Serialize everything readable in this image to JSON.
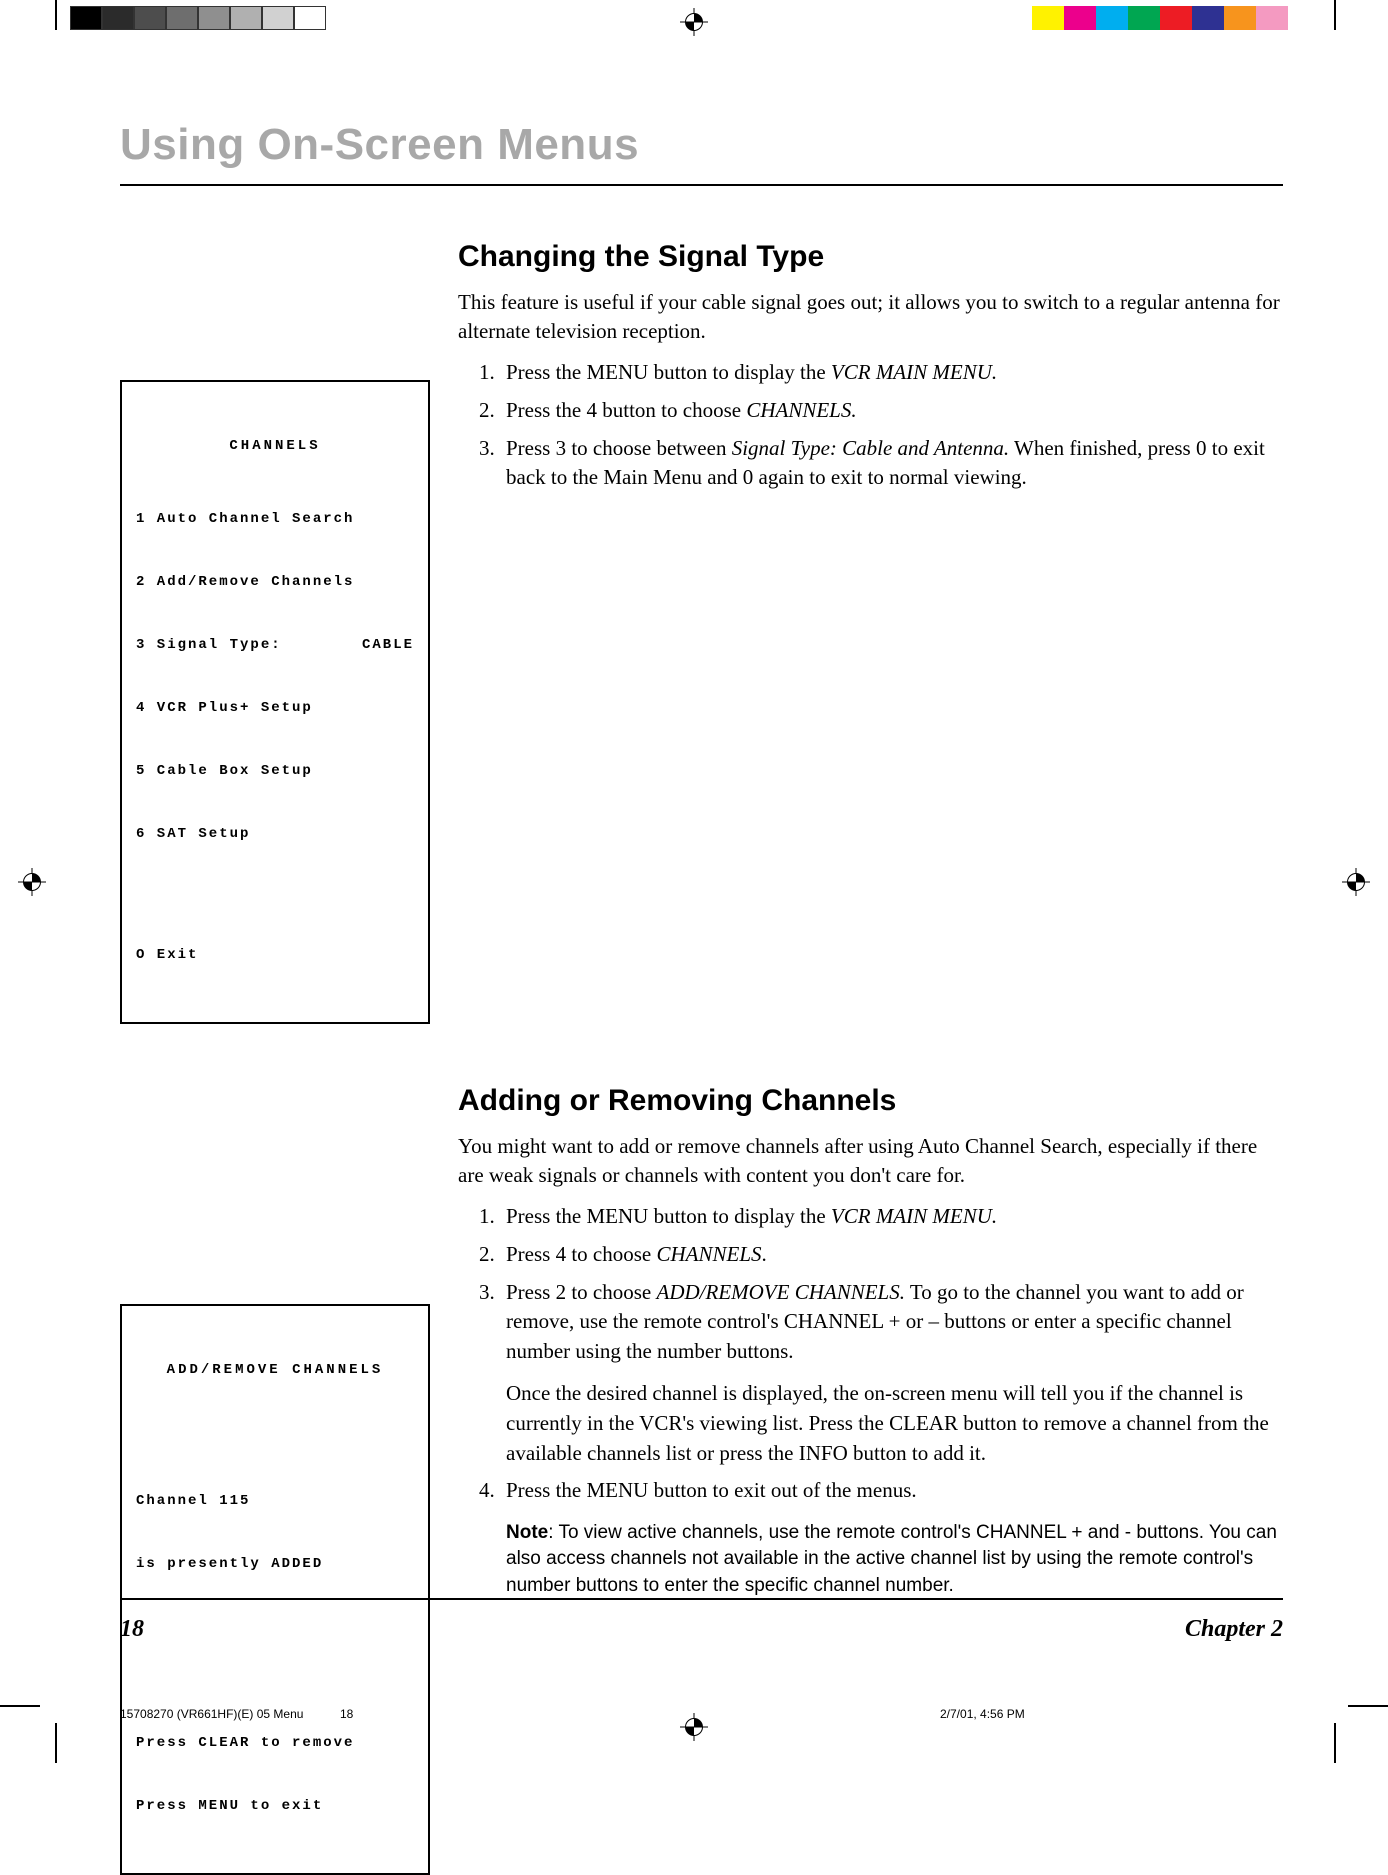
{
  "pageTitle": "Using On-Screen Menus",
  "section1": {
    "heading": "Changing the Signal Type",
    "intro": "This feature is useful if your cable signal goes out; it allows you to switch to a regular antenna for alternate television reception.",
    "step1_a": "Press the MENU button to display the ",
    "step1_i": "VCR MAIN MENU.",
    "step2_a": "Press the 4 button to choose ",
    "step2_i": "CHANNELS.",
    "step3_a": "Press 3 to choose between ",
    "step3_i": "Signal Type: Cable and Antenna.",
    "step3_b": " When finished, press 0 to exit back to the Main Menu and 0 again to exit to normal viewing."
  },
  "osd1": {
    "title": "CHANNELS",
    "l1": "1 Auto Channel Search",
    "l2": "2 Add/Remove Channels",
    "l3a": "3 Signal Type:",
    "l3b": "CABLE",
    "l4": "4 VCR Plus+ Setup",
    "l5": "5 Cable Box Setup",
    "l6": "6 SAT Setup",
    "exit": "O Exit"
  },
  "section2": {
    "heading": "Adding or Removing Channels",
    "intro": "You might want to add or remove channels after using Auto Channel Search, especially if there are weak signals or channels with content you don't care for.",
    "step1_a": "Press the MENU button to display the ",
    "step1_i": "VCR MAIN MENU.",
    "step2_a": "Press 4 to choose ",
    "step2_i": "CHANNELS",
    "step2_b": ".",
    "step3_a": "Press 2 to choose ",
    "step3_i": "ADD/REMOVE CHANNELS.",
    "step3_b": " To go to the channel you want to add or remove, use the remote control's CHANNEL + or – buttons or enter a specific channel number using the number buttons.",
    "step3_extra": "Once the desired channel is displayed, the on-screen menu will tell you if the channel is currently in the VCR's viewing list. Press the CLEAR button to remove a channel from the available channels list or press the INFO button to add it.",
    "step4": "Press the MENU button to exit out of the menus.",
    "note_label": "Note",
    "note_body": ": To view active channels, use the remote control's CHANNEL + and - buttons. You can also access channels not available in the active channel list by using the remote control's number buttons to enter the specific channel number."
  },
  "osd2": {
    "title": "ADD/REMOVE CHANNELS",
    "l1": "Channel 115",
    "l2": "is presently ADDED",
    "l3": "Press CLEAR to remove",
    "l4": "Press MENU to exit"
  },
  "footer": {
    "pageNumber": "18",
    "chapter": "Chapter 2"
  },
  "printFooter": {
    "doc": "15708270 (VR661HF)(E) 05 Menu",
    "page": "18",
    "datetime": "2/7/01, 4:56 PM"
  },
  "greys": [
    "#000000",
    "#2b2b2b",
    "#4d4d4d",
    "#6e6e6e",
    "#8f8f8f",
    "#b0b0b0",
    "#d1d1d1",
    "#ffffff"
  ],
  "colors": [
    "#fff200",
    "#ec008c",
    "#00aeef",
    "#00a651",
    "#ed1c24",
    "#2e3192",
    "#f7941d",
    "#f49ac1",
    "#ffffff"
  ]
}
